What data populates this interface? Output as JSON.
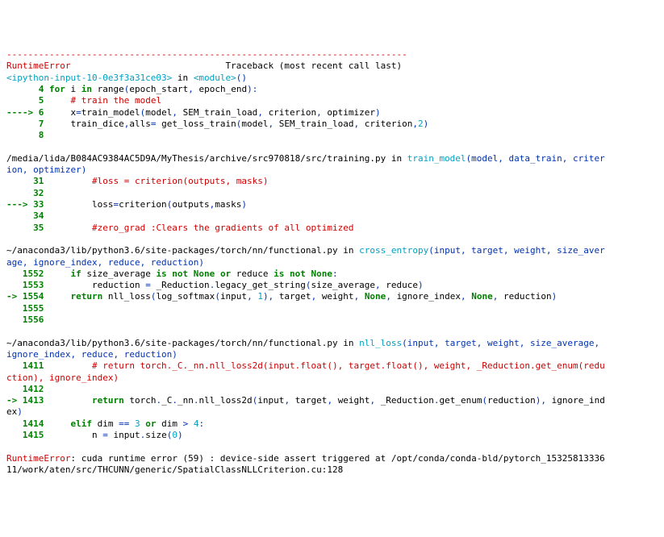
{
  "divider": "---------------------------------------------------------------------------",
  "err_class": "RuntimeError",
  "err_head_rest": "                             Traceback (most recent call last)",
  "loc1_a": "<ipython-input-10-0e3f3a31ce03>",
  "loc1_b": " in ",
  "loc1_c": "<module>",
  "loc1_d": "()",
  "l4_no": "      4",
  "l4_a": " for",
  "l4_b": " i ",
  "l4_c": "in",
  "l4_d": " range",
  "l4_e": "(",
  "l4_f": "epoch_start",
  "l4_g": ", ",
  "l4_h": "epoch_end",
  "l4_i": "):",
  "l5_no": "      5",
  "l5_a": "     ",
  "l5_b": "# train the model",
  "l6_arrow": "----> 6",
  "l6_a": "     x",
  "l6_b": "=",
  "l6_c": "train_model",
  "l6_d": "(",
  "l6_e": "model",
  "l6_f": ", ",
  "l6_g": "SEM_train_load",
  "l6_h": ", ",
  "l6_i": "criterion",
  "l6_j": ", ",
  "l6_k": "optimizer",
  "l6_l": ")",
  "l7_no": "      7",
  "l7_a": "     train_dice",
  "l7_b": ",",
  "l7_c": "alls",
  "l7_d": "= ",
  "l7_e": "get_loss_train",
  "l7_f": "(",
  "l7_g": "model",
  "l7_h": ", ",
  "l7_i": "SEM_train_load",
  "l7_j": ", ",
  "l7_k": "criterion",
  "l7_l": ",",
  "l7_m": "2",
  "l7_n": ")",
  "l8_no": "      8",
  "blank": "",
  "loc2_a": "/media/lida/B084AC9384AC5D9A/MyThesis/archive/src970818/src/training.py",
  "loc2_b": " in ",
  "loc2_c": "train_model",
  "loc2_d1": "(model, data_train, criter",
  "loc2_d2": "ion, optimizer)",
  "l31_no": "     31",
  "l31_a": "         ",
  "l31_b": "#loss = criterion(outputs, masks)",
  "l32_no": "     32",
  "l33_arrow": "---> 33",
  "l33_a": "         loss",
  "l33_b": "=",
  "l33_c": "criterion",
  "l33_d": "(",
  "l33_e": "outputs",
  "l33_f": ",",
  "l33_g": "masks",
  "l33_h": ")",
  "l34_no": "     34",
  "l35_no": "     35",
  "l35_a": "         ",
  "l35_b": "#zero_grad :Clears the gradients of all optimized",
  "loc3_a": "~/anaconda3/lib/python3.6/site-packages/torch/nn/functional.py",
  "loc3_b": " in ",
  "loc3_c": "cross_entropy",
  "loc3_d1": "(input, target, weight, size_aver",
  "loc3_d2": "age, ignore_index, reduce, reduction)",
  "l1552_no": "   1552",
  "l1552_a": "     if",
  "l1552_b": " size_average ",
  "l1552_c": "is not",
  "l1552_d": " None ",
  "l1552_e": "or",
  "l1552_f": " reduce ",
  "l1552_g": "is not",
  "l1552_h": " None",
  "l1552_i": ":",
  "l1553_no": "   1553",
  "l1553_a": "         reduction ",
  "l1553_b": "= ",
  "l1553_c": "_Reduction",
  "l1553_d": ".",
  "l1553_e": "legacy_get_string",
  "l1553_f": "(",
  "l1553_g": "size_average",
  "l1553_h": ", ",
  "l1553_i": "reduce",
  "l1553_j": ")",
  "l1554_arrow": "-> 1554",
  "l1554_a": "     return",
  "l1554_b": " nll_loss",
  "l1554_c": "(",
  "l1554_d": "log_softmax",
  "l1554_e": "(",
  "l1554_f": "input",
  "l1554_g": ", ",
  "l1554_h": "1",
  "l1554_i": "), ",
  "l1554_j": "target",
  "l1554_k": ", ",
  "l1554_l": "weight",
  "l1554_m": ", ",
  "l1554_n": "None",
  "l1554_o": ", ",
  "l1554_p": "ignore_index",
  "l1554_q": ", ",
  "l1554_r": "None",
  "l1554_s": ", ",
  "l1554_t": "reduction",
  "l1554_u": ")",
  "l1555_no": "   1555",
  "l1556_no": "   1556",
  "loc4_a": "~/anaconda3/lib/python3.6/site-packages/torch/nn/functional.py",
  "loc4_b": " in ",
  "loc4_c": "nll_loss",
  "loc4_d1": "(input, target, weight, size_average, ",
  "loc4_d2": "ignore_index, reduce, reduction)",
  "l1411_no": "   1411",
  "l1411_a": "         ",
  "l1411_b1": "# return torch._C._nn.nll_loss2d(input.float(), target.float(), weight, _Reduction.get_enum(redu",
  "l1411_b2": "ction), ignore_index)",
  "l1412_no": "   1412",
  "l1413_arrow": "-> 1413",
  "l1413_a": "         return",
  "l1413_b": " torch",
  "l1413_c": ".",
  "l1413_d": "_C",
  "l1413_e": ".",
  "l1413_f": "_nn",
  "l1413_g": ".",
  "l1413_h": "nll_loss2d",
  "l1413_i": "(",
  "l1413_j": "input",
  "l1413_k": ", ",
  "l1413_l": "target",
  "l1413_m": ", ",
  "l1413_n": "weight",
  "l1413_o": ", ",
  "l1413_p": "_Reduction",
  "l1413_q": ".",
  "l1413_r": "get_enum",
  "l1413_s": "(",
  "l1413_t": "reduction",
  "l1413_u": "), ",
  "l1413_v": "ignore_ind",
  "l1413_w": "ex",
  "l1413_x": ")",
  "l1414_no": "   1414",
  "l1414_a": "     elif",
  "l1414_b": " dim ",
  "l1414_c": "== ",
  "l1414_d": "3",
  "l1414_e": " or",
  "l1414_f": " dim ",
  "l1414_g": "> ",
  "l1414_h": "4",
  "l1414_i": ":",
  "l1415_no": "   1415",
  "l1415_a": "         n ",
  "l1415_b": "= ",
  "l1415_c": "input",
  "l1415_d": ".",
  "l1415_e": "size",
  "l1415_f": "(",
  "l1415_g": "0",
  "l1415_h": ")",
  "final_a": "RuntimeError",
  "final_b": ": cuda runtime error (59) : device-side assert triggered at /opt/conda/conda-bld/pytorch_15325813336",
  "final_c": "11/work/aten/src/THCUNN/generic/SpatialClassNLLCriterion.cu:128"
}
